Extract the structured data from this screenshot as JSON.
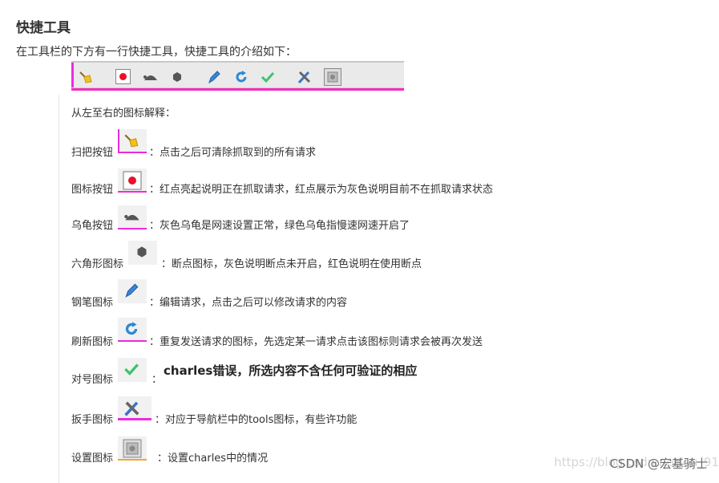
{
  "header": {
    "title": "快捷工具",
    "intro": "在工具栏的下方有一行快捷工具，快捷工具的介绍如下："
  },
  "toolbar_icons": [
    "broom-icon",
    "record-icon",
    "turtle-icon",
    "hexagon-icon",
    "pen-icon",
    "refresh-icon",
    "check-icon",
    "tools-icon",
    "settings-icon"
  ],
  "subheading": "从左至右的图标解释：",
  "items": [
    {
      "label": "扫把按钮",
      "desc": "：点击之后可清除抓取到的所有请求",
      "icon": "broom-icon"
    },
    {
      "label": "图标按钮",
      "desc": "：红点亮起说明正在抓取请求，红点展示为灰色说明目前不在抓取请求状态",
      "icon": "record-icon"
    },
    {
      "label": "乌龟按钮",
      "desc": "：灰色乌龟是网速设置正常，绿色乌龟指慢速网速开启了",
      "icon": "turtle-icon"
    },
    {
      "label": "六角形图标",
      "desc": "：断点图标，灰色说明断点未开启，红色说明在使用断点",
      "icon": "hexagon-icon"
    },
    {
      "label": "钢笔图标",
      "desc": "：编辑请求，点击之后可以修改请求的内容",
      "icon": "pen-icon"
    },
    {
      "label": "刷新图标",
      "desc": "：重复发送请求的图标，先选定某一请求点击该图标则请求会被再次发送",
      "icon": "refresh-icon"
    },
    {
      "label": "对号图标",
      "desc": "：",
      "extra": "charles错误，所选内容不含任何可验证的相应",
      "icon": "check-icon"
    },
    {
      "label": "扳手图标",
      "desc": "：对应于导航栏中的tools图标，有些许功能",
      "icon": "tools-icon"
    },
    {
      "label": "设置图标",
      "desc": "：设置charles中的情况",
      "icon": "settings-icon"
    }
  ],
  "watermark": {
    "text": "CSDN @宏基骑士",
    "faint": "https://blog.csdn.net/ou_91"
  },
  "colors": {
    "accent_pink": "#ee2bdc",
    "text": "#333333",
    "record_red": "#e8112d",
    "refresh_blue": "#2a8ad6",
    "check_green": "#3cc46a"
  }
}
